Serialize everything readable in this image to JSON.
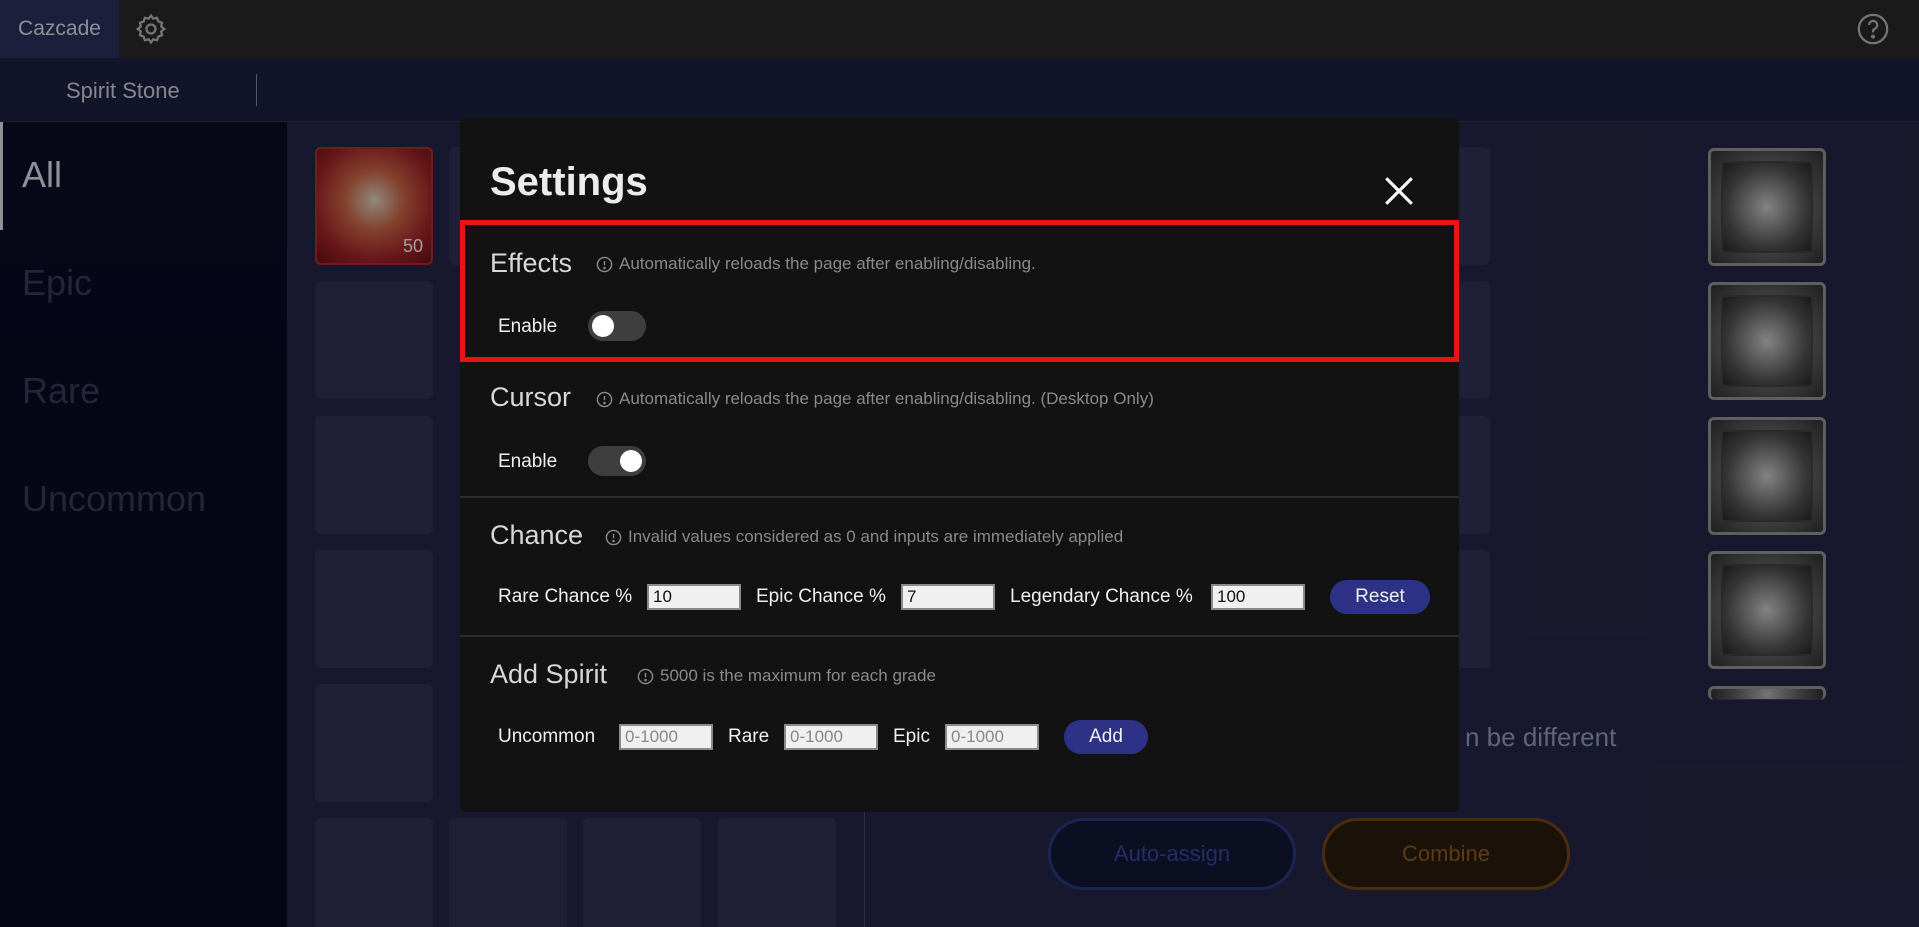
{
  "app": {
    "brand": "Cazcade"
  },
  "subnav": {
    "tab": "Spirit Stone"
  },
  "sidebar": {
    "items": [
      "All",
      "Epic",
      "Rare",
      "Uncommon"
    ]
  },
  "background": {
    "slot_level": "50",
    "partial_text": "n be different",
    "auto_assign_label": "Auto-assign",
    "combine_label": "Combine"
  },
  "modal": {
    "title": "Settings",
    "effects": {
      "title": "Effects",
      "hint": "Automatically reloads the page after enabling/disabling.",
      "enable_label": "Enable",
      "enabled": false
    },
    "cursor": {
      "title": "Cursor",
      "hint": "Automatically reloads the page after enabling/disabling. (Desktop Only)",
      "enable_label": "Enable",
      "enabled": true
    },
    "chance": {
      "title": "Chance",
      "hint": "Invalid values considered as 0 and inputs are immediately applied",
      "rare_label": "Rare Chance %",
      "rare_value": "10",
      "epic_label": "Epic Chance %",
      "epic_value": "7",
      "legendary_label": "Legendary Chance %",
      "legendary_value": "100",
      "reset_label": "Reset"
    },
    "add_spirit": {
      "title": "Add Spirit",
      "hint": "5000 is the maximum for each grade",
      "uncommon_label": "Uncommon",
      "uncommon_placeholder": "0-1000",
      "rare_label": "Rare",
      "rare_placeholder": "0-1000",
      "epic_label": "Epic",
      "epic_placeholder": "0-1000",
      "add_label": "Add"
    }
  },
  "colors": {
    "highlight": "#e8131b",
    "accent_button": "#2d3286"
  }
}
